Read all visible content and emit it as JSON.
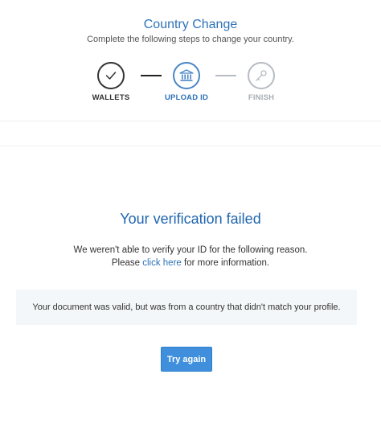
{
  "header": {
    "title": "Country Change",
    "subtitle": "Complete the following steps to change your country."
  },
  "steps": [
    {
      "label": "WALLETS",
      "icon": "checkmark-icon",
      "state": "completed"
    },
    {
      "label": "UPLOAD ID",
      "icon": "bank-icon",
      "state": "active"
    },
    {
      "label": "FINISH",
      "icon": "key-icon",
      "state": "pending"
    }
  ],
  "result": {
    "title": "Your verification failed",
    "reason_line1": "We weren't able to verify your ID for the following reason.",
    "reason_prefix": "Please ",
    "reason_link": "click here",
    "reason_suffix": " for more information.",
    "notice": "Your document was valid, but was from a country that didn't match your profile.",
    "button_label": "Try again"
  },
  "colors": {
    "accent": "#2d72b8",
    "button": "#3f8fdd",
    "notice_bg": "#f4f7f9",
    "pending": "#b7bcc2"
  }
}
